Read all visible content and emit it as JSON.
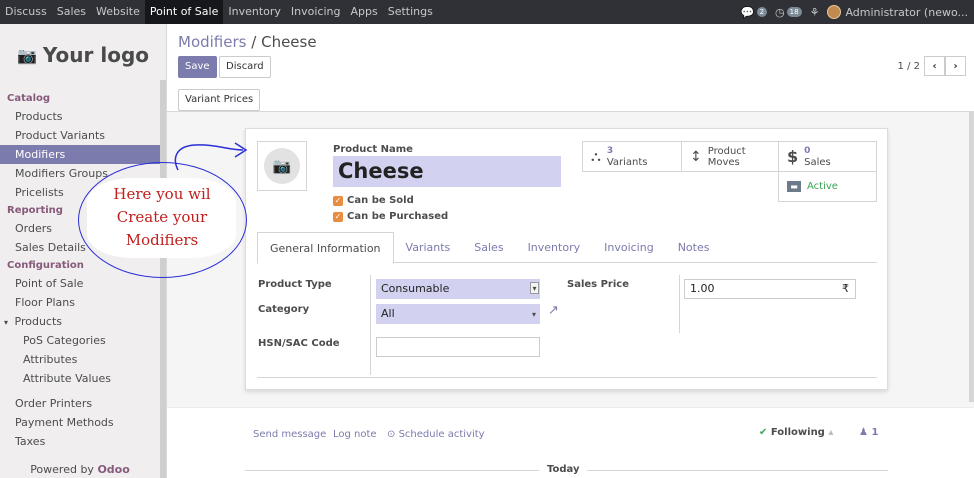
{
  "topbar": {
    "menu": [
      "Discuss",
      "Sales",
      "Website",
      "Point of Sale",
      "Inventory",
      "Invoicing",
      "Apps",
      "Settings"
    ],
    "active_menu": "Point of Sale",
    "chat_badge": "2",
    "activity_badge": "18",
    "user": "Administrator (newo..."
  },
  "sidebar": {
    "logo_text": "Your logo",
    "catalog_title": "Catalog",
    "catalog_items": [
      "Products",
      "Product Variants",
      "Modifiers",
      "Modifiers Groups",
      "Pricelists"
    ],
    "active_item": "Modifiers",
    "reporting_title": "Reporting",
    "reporting_items": [
      "Orders",
      "Sales Details"
    ],
    "configuration_title": "Configuration",
    "configuration_items": [
      "Point of Sale",
      "Floor Plans"
    ],
    "products_group": "Products",
    "products_sub": [
      "PoS Categories",
      "Attributes",
      "Attribute Values"
    ],
    "more_items": [
      "Order Printers",
      "Payment Methods",
      "Taxes"
    ],
    "powered_by": "Powered by",
    "powered_brand": "Odoo"
  },
  "control_panel": {
    "breadcrumb_parent": "Modifiers",
    "breadcrumb_sep": "/",
    "breadcrumb_current": "Cheese",
    "save_label": "Save",
    "discard_label": "Discard",
    "pager": "1 / 2",
    "variant_prices_label": "Variant Prices"
  },
  "form": {
    "product_name_label": "Product Name",
    "product_name": "Cheese",
    "can_be_sold": "Can be Sold",
    "can_be_purchased": "Can be Purchased",
    "stat_variants_count": "3",
    "stat_variants_label": "Variants",
    "stat_moves_line1": "Product",
    "stat_moves_line2": "Moves",
    "stat_sales_count": "0",
    "stat_sales_label": "Sales",
    "stat_active_label": "Active",
    "tabs": [
      "General Information",
      "Variants",
      "Sales",
      "Inventory",
      "Invoicing",
      "Notes"
    ],
    "active_tab": "General Information",
    "product_type_label": "Product Type",
    "product_type_value": "Consumable",
    "category_label": "Category",
    "category_value": "All",
    "hsn_label": "HSN/SAC Code",
    "hsn_value": "",
    "sales_price_label": "Sales Price",
    "sales_price_value": "1.00",
    "currency_symbol": "₹"
  },
  "chatter": {
    "send_message": "Send message",
    "log_note": "Log note",
    "schedule_activity": "Schedule activity",
    "following": "Following",
    "followers_count": "1",
    "today": "Today"
  },
  "annotation": {
    "line1": "Here you wil",
    "line2": "Create your",
    "line3": "Modifiers"
  },
  "colors": {
    "brand": "#875a7b",
    "accent": "#7c7bad",
    "highlight_field": "#d2d2f0",
    "annotation_stroke": "#2b2fd6",
    "annotation_text": "#c0201e"
  }
}
